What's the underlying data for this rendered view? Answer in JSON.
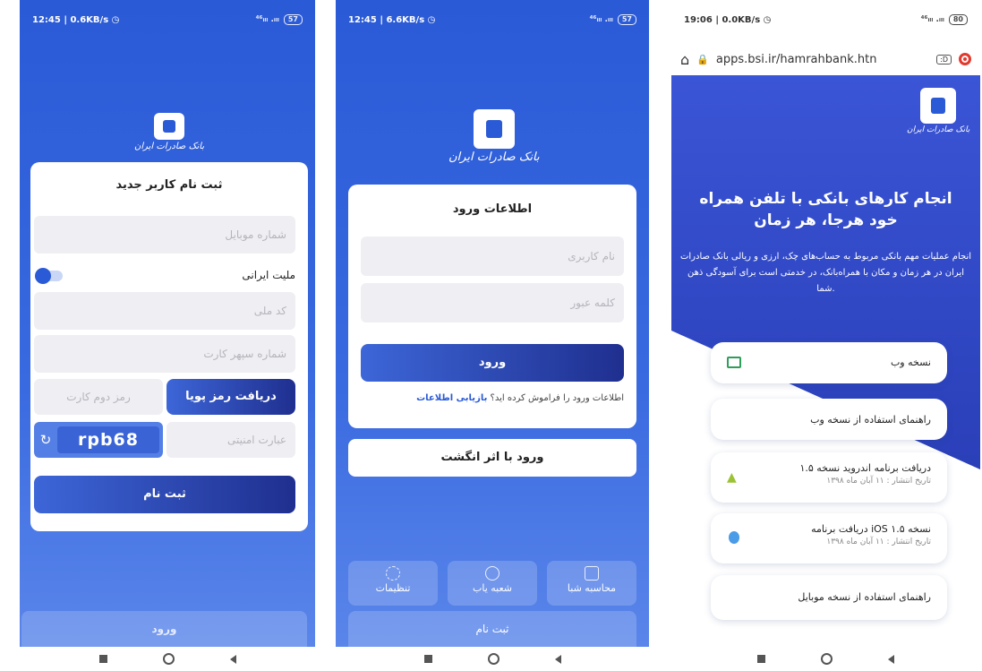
{
  "screen1": {
    "status": {
      "time": "12:45",
      "speed": "0.6KB/s",
      "signal": "⁴⁶ᵢₗₗ .ᵢₗₗ",
      "battery": "57"
    },
    "logo_text": "بانک صادرات ایران",
    "card_title": "ثبت نام کاربر جدید",
    "mobile_placeholder": "شماره موبایل",
    "nationality_label": "ملیت ایرانی",
    "national_code_placeholder": "کد ملی",
    "card_number_placeholder": "شماره سپهر کارت",
    "second_pin_placeholder": "رمز دوم کارت",
    "get_otp_label": "دریافت رمز پویا",
    "captcha_text": "rpb68",
    "security_phrase_placeholder": "عبارت امنیتی",
    "register_label": "ثبت نام",
    "login_label": "ورود"
  },
  "screen2": {
    "status": {
      "time": "12:45",
      "speed": "6.6KB/s",
      "signal": "⁴⁶ᵢₗₗ .ᵢₗₗ",
      "battery": "57"
    },
    "logo_text": "بانک صادرات ایران",
    "card_title": "اطلاعات ورود",
    "username_placeholder": "نام کاربری",
    "password_placeholder": "کلمه عبور",
    "login_label": "ورود",
    "forgot_text": "اطلاعات ورود را فراموش کرده اید؟",
    "recover_link": "بازیابی اطلاعات",
    "fingerprint_label": "ورود با اثر انگشت",
    "tiles": [
      "محاسبه شبا",
      "شعبه یاب",
      "تنظیمات"
    ],
    "register_label": "ثبت نام"
  },
  "screen3": {
    "status": {
      "time": "19:06",
      "speed": "0.0KB/s",
      "signal": "⁴⁶ᵢₗₗ .ᵢₗₗ",
      "battery": "80"
    },
    "url": "apps.bsi.ir/hamrahbank.htn",
    "tab_count": ":D",
    "logo_text": "بانک صادرات ایران",
    "headline": "انجام کارهای بانکی با تلفن همراه خود هرجا، هر زمان",
    "description": "انجام عملیات مهم بانکی مربوط به حساب‌های چک، ارزی و ریالی بانک صادرات ایران در هر زمان و مکان با همراه‌بانک، در خدمتی است برای آسودگی ذهن شما.",
    "items": [
      {
        "title": "نسخه وب",
        "sub": ""
      },
      {
        "title": "راهنمای استفاده از نسخه وب",
        "sub": ""
      },
      {
        "title": "دریافت برنامه اندروید نسخه ۱.۵",
        "sub": "تاریخ انتشار : ۱۱ آبان ماه ۱۳۹۸"
      },
      {
        "title": "دریافت برنامه iOS نسخه ۱.۵",
        "sub": "تاریخ انتشار : ۱۱ آبان ماه ۱۳۹۸"
      },
      {
        "title": "راهنمای استفاده از نسخه موبایل",
        "sub": ""
      }
    ]
  }
}
